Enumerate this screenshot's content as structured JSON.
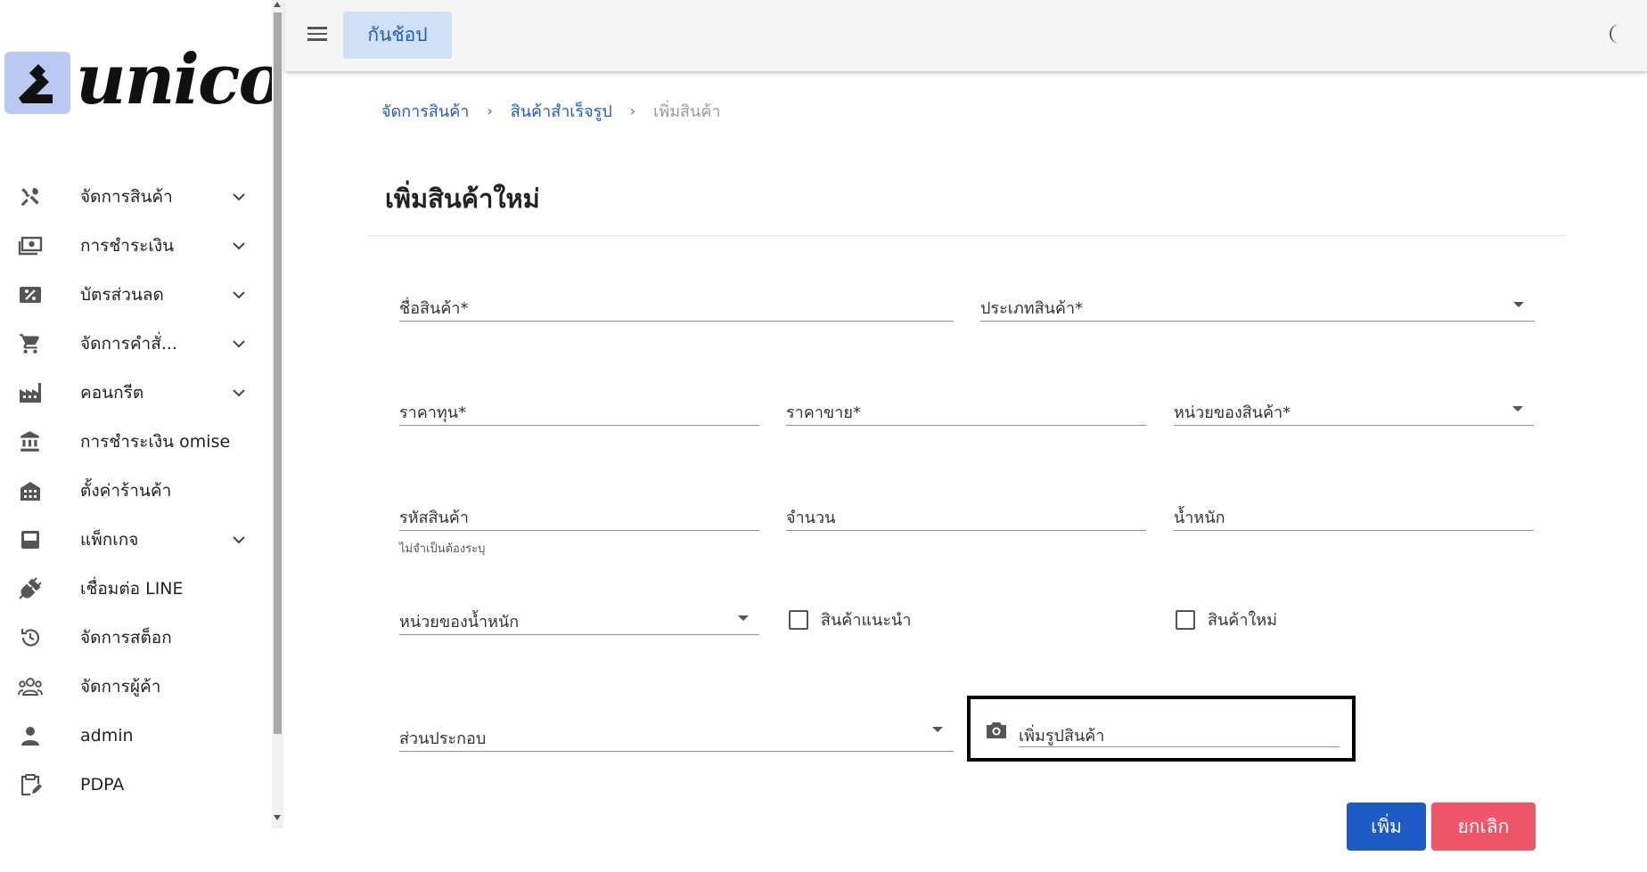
{
  "brand": {
    "logo_text": "unicon"
  },
  "sidebar": {
    "items": [
      {
        "label": "จัดการสินค้า",
        "icon": "tools-icon",
        "expandable": true
      },
      {
        "label": "การชำระเงิน",
        "icon": "payments-icon",
        "expandable": true
      },
      {
        "label": "บัตรส่วนลด",
        "icon": "coupon-icon",
        "expandable": true
      },
      {
        "label": "จัดการคำสั่...",
        "icon": "cart-icon",
        "expandable": true
      },
      {
        "label": "คอนกรีต",
        "icon": "factory-icon",
        "expandable": true
      },
      {
        "label": "การชำระเงิน omise",
        "icon": "bank-icon",
        "expandable": false
      },
      {
        "label": "ตั้งค่าร้านค้า",
        "icon": "store-icon",
        "expandable": false
      },
      {
        "label": "แพ็กเกจ",
        "icon": "package-icon",
        "expandable": true
      },
      {
        "label": "เชื่อมต่อ LINE",
        "icon": "plug-icon",
        "expandable": false
      },
      {
        "label": "จัดการสต็อก",
        "icon": "history-icon",
        "expandable": false
      },
      {
        "label": "จัดการผู้ค้า",
        "icon": "group-icon",
        "expandable": false
      },
      {
        "label": "admin",
        "icon": "person-icon",
        "expandable": false
      },
      {
        "label": "PDPA",
        "icon": "clipboard-icon",
        "expandable": false
      }
    ]
  },
  "topbar": {
    "shop_label": "กันช้อป",
    "menu_icon": "hamburger-icon",
    "theme_icon": "moon-icon"
  },
  "breadcrumb": {
    "items": [
      "จัดการสินค้า",
      "สินค้าสำเร็จรูป"
    ],
    "current": "เพิ่มสินค้า",
    "separator": "›"
  },
  "page": {
    "title": "เพิ่มสินค้าใหม่"
  },
  "form": {
    "product_name": "ชื่อสินค้า*",
    "product_type": "ประเภทสินค้า*",
    "cost_price": "ราคาทุน*",
    "sale_price": "ราคาขาย*",
    "unit": "หน่วยของสินค้า*",
    "product_code": "รหัสสินค้า",
    "product_code_helper": "ไม่จำเป็นต้องระบุ",
    "quantity": "จำนวน",
    "weight": "น้ำหนัก",
    "weight_unit": "หน่วยของน้ำหนัก",
    "recommended": "สินค้าแนะนำ",
    "new_product": "สินค้าใหม่",
    "ingredients": "ส่วนประกอบ",
    "add_image": "เพิ่มรูปสินค้า"
  },
  "actions": {
    "add": "เพิ่ม",
    "cancel": "ยกเลิก"
  },
  "colors": {
    "primary": "#1e5bc6",
    "danger": "#f0566a",
    "shop_button_bg": "#cfe0f7",
    "logo_box": "#b9c9f2"
  }
}
